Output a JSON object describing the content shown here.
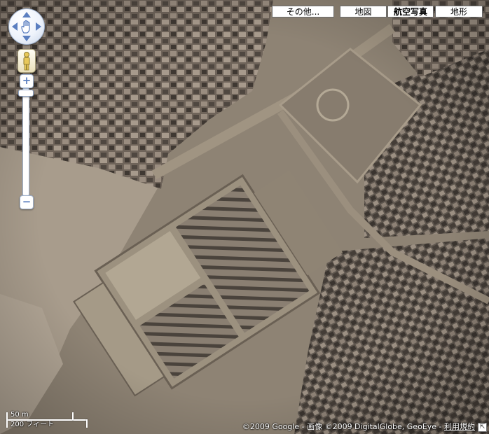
{
  "map_types": {
    "more_label": "その他...",
    "map_label": "地図",
    "satellite_label": "航空写真",
    "terrain_label": "地形",
    "active": "航空写真"
  },
  "scale": {
    "metric_label": "50 m",
    "imperial_label": "200 フィート"
  },
  "attribution": {
    "text": "©2009 Google - 画像 ©2009 DigitalGlobe, GeoEye - ",
    "terms_label": "利用規約"
  },
  "colors": {
    "control_blue": "#5b7fc0",
    "button_border": "#6b6b6b"
  }
}
